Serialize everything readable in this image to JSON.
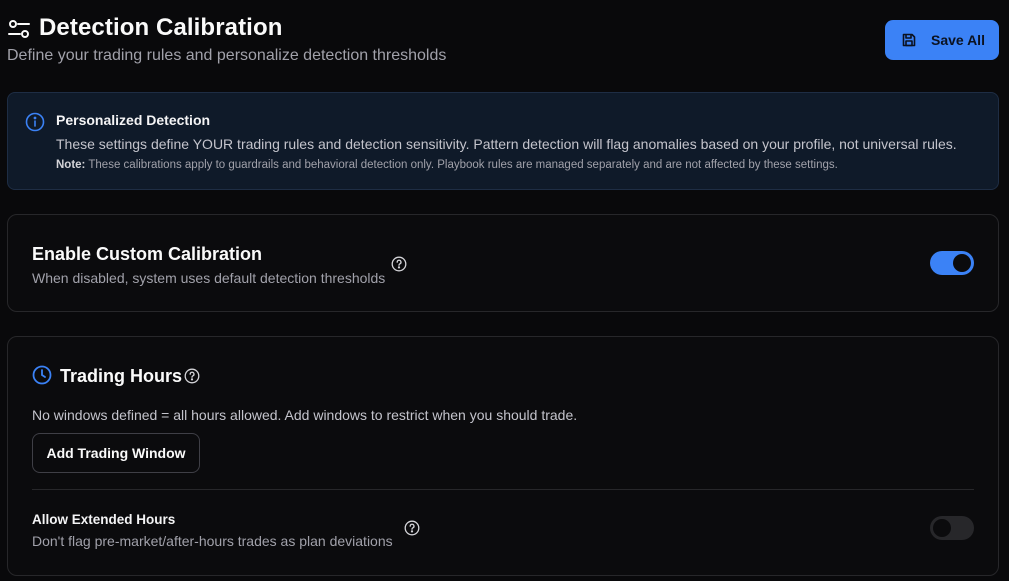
{
  "header": {
    "title": "Detection Calibration",
    "subtitle": "Define your trading rules and personalize detection thresholds",
    "icon": "sliders-icon",
    "save_label": "Save All"
  },
  "info_banner": {
    "title": "Personalized Detection",
    "text": "These settings define YOUR trading rules and detection sensitivity. Pattern detection will flag anomalies based on your profile, not universal rules.",
    "note_label": "Note:",
    "note_text": "These calibrations apply to guardrails and behavioral detection only. Playbook rules are managed separately and are not affected by these settings."
  },
  "custom_calibration": {
    "title": "Enable Custom Calibration",
    "description": "When disabled, system uses default detection thresholds",
    "enabled": true
  },
  "trading_hours": {
    "title": "Trading Hours",
    "description": "No windows defined = all hours allowed. Add windows to restrict when you should trade.",
    "add_button_label": "Add Trading Window",
    "extended_hours": {
      "title": "Allow Extended Hours",
      "description": "Don't flag pre-market/after-hours trades as plan deviations",
      "enabled": false
    }
  },
  "colors": {
    "accent": "#3b82f6",
    "background": "#09090b",
    "card_border": "#27272a",
    "banner_background": "#0f1a29"
  }
}
